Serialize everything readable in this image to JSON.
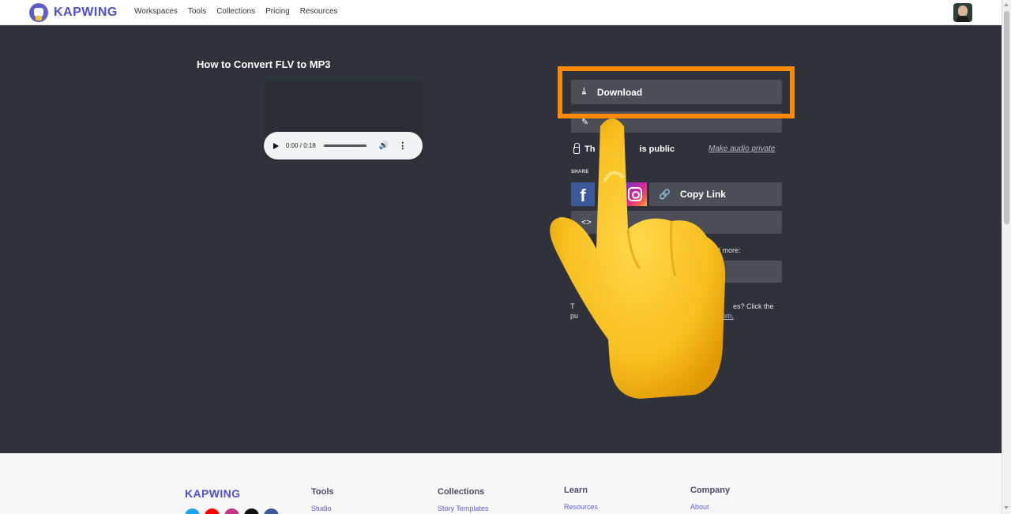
{
  "header": {
    "logo_text": "KAPWING",
    "nav": [
      "Workspaces",
      "Tools",
      "Collections",
      "Pricing",
      "Resources"
    ]
  },
  "main": {
    "title": "How to Convert FLV to MP3",
    "audio": {
      "time": "0:00 / 0:18",
      "progress": 0
    },
    "download_label": "Download",
    "privacy_text": "This audio is public",
    "privacy_visible_start": "Th",
    "privacy_visible_end": "is public",
    "privacy_link": "Make audio private",
    "share_label": "SHARE",
    "facebook_glyph": "f",
    "copy_link_label": "Copy Link",
    "embed_icon": "<>",
    "more_text": "nd more:",
    "note_start": "T",
    "note_right": "es? Click the",
    "note_line2_start": "pu",
    "note_line2_link": "g.com",
    "note_line2_end": "."
  },
  "footer": {
    "logo_text": "KAPWING",
    "columns": [
      {
        "head": "Tools",
        "link": "Studio"
      },
      {
        "head": "Collections",
        "link": "Story Templates"
      },
      {
        "head": "Learn",
        "link": "Resources"
      },
      {
        "head": "Company",
        "link": "About"
      }
    ],
    "social_colors": [
      "#1da1f2",
      "#ff0000",
      "#c13584",
      "#111111",
      "#3b5998"
    ]
  },
  "colors": {
    "highlight": "#ff8c00",
    "brand": "#4f4fcf",
    "page_bg": "#2f323b"
  }
}
